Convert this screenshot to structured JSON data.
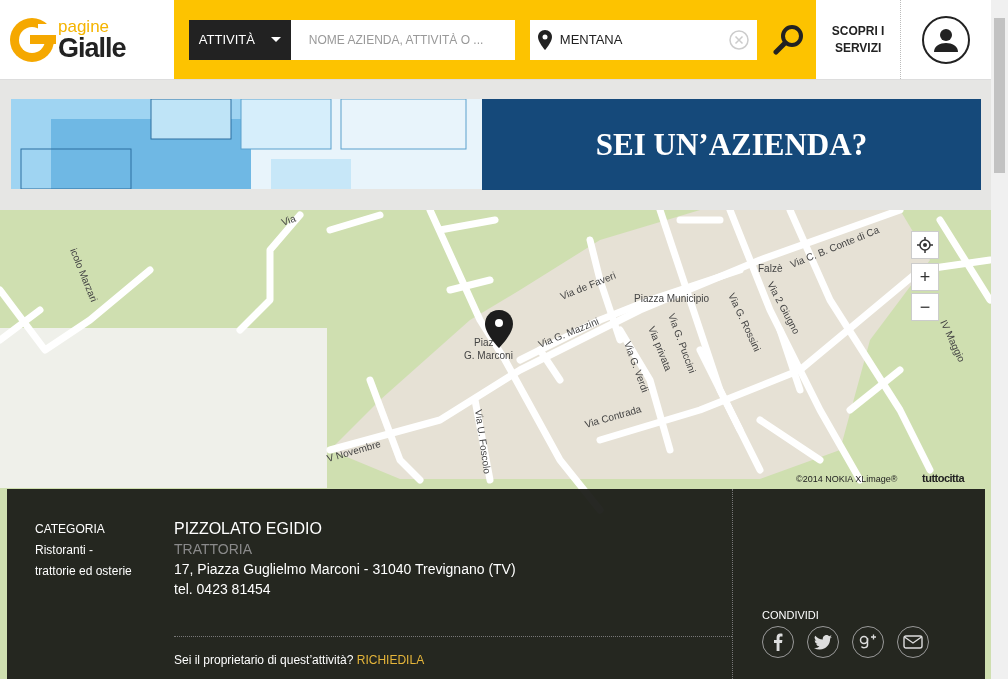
{
  "header": {
    "logo": {
      "top": "pagine",
      "bottom": "Gialle"
    },
    "category_dropdown": "ATTIVITÀ",
    "search": {
      "placeholder": "NOME AZIENDA, ATTIVITÀ O ..."
    },
    "location": {
      "value": "MENTANA"
    },
    "services_link": "SCOPRI I\nSERVIZI"
  },
  "banner": {
    "headline": "SEI UN’AZIENDA?"
  },
  "map": {
    "labels": [
      "icolo Marzari",
      "Via",
      "Via de Faveri",
      "Piazza Municipio",
      "Piaz",
      "G. Marconi",
      "Via G. Mazzini",
      "Falzè",
      "Via C. B. Conte di Ca",
      "Via 2 Giugno",
      "Via G. Rossini",
      "Via G. Puccini",
      "Via privata",
      "Via G. Verdi",
      "Via Contrada",
      "V Novembre",
      "Via U. Foscolo",
      "IV Maggio"
    ],
    "copyright": "©2014 NOKIA XLimage®",
    "provider": "tuttocitta",
    "zoom_in": "+",
    "zoom_out": "−"
  },
  "listing": {
    "category_label": "CATEGORIA",
    "category": "Ristoranti -\ntrattorie ed osterie",
    "name": "PIZZOLATO EGIDIO",
    "type": "TRATTORIA",
    "address": "17, Piazza Guglielmo Marconi - 31040 Trevignano (TV)",
    "phone": "tel. 0423 81454",
    "owner_question": "Sei il proprietario di quest’attività?",
    "claim_link": "RICHIEDILA",
    "share_label": "CONDIVIDI",
    "share": [
      {
        "kind": "facebook"
      },
      {
        "kind": "twitter"
      },
      {
        "kind": "googleplus"
      },
      {
        "kind": "email"
      }
    ]
  }
}
